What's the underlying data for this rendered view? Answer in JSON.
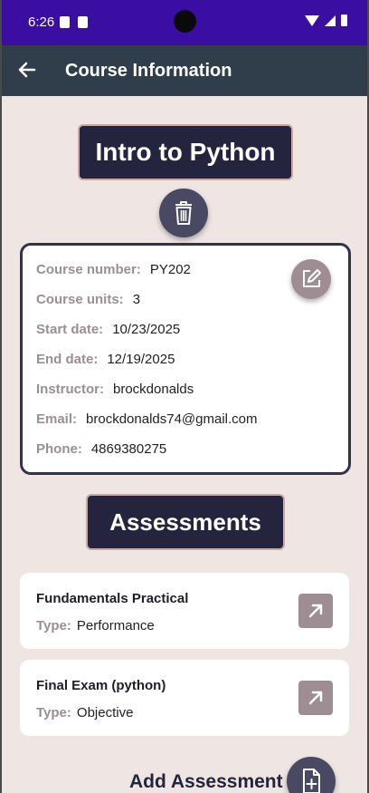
{
  "status_bar": {
    "time": "6:26",
    "icons": [
      "notification-icon",
      "app-icon",
      "wifi-icon",
      "signal-icon",
      "battery-icon"
    ]
  },
  "app_bar": {
    "title": "Course Information",
    "back_icon": "arrow-left-icon",
    "color": "#2f3e4a"
  },
  "course": {
    "title": "Intro to Python",
    "delete_icon": "trash-icon",
    "edit_icon": "edit-icon",
    "fields": [
      {
        "label": "Course number:",
        "value": "PY202"
      },
      {
        "label": "Course units:",
        "value": "3"
      },
      {
        "label": "Start date:",
        "value": "10/23/2025"
      },
      {
        "label": "End date:",
        "value": "12/19/2025"
      },
      {
        "label": "Instructor:",
        "value": "brockdonalds"
      },
      {
        "label": "Email:",
        "value": "brockdonalds74@gmail.com"
      },
      {
        "label": "Phone:",
        "value": "4869380275"
      }
    ]
  },
  "assessments": {
    "heading": "Assessments",
    "items": [
      {
        "name": "Fundamentals Practical",
        "type_label": "Type:",
        "type_value": "Performance",
        "open_icon": "open-external-icon"
      },
      {
        "name": "Final Exam (python)",
        "type_label": "Type:",
        "type_value": "Objective",
        "open_icon": "open-external-icon"
      }
    ],
    "add_label": "Add Assessment",
    "add_icon": "add-document-icon"
  },
  "colors": {
    "status_bar": "#3a0ea3",
    "background": "#efe5e2",
    "dark_pill": "#25243e",
    "accent_muted": "#9e8e93"
  }
}
